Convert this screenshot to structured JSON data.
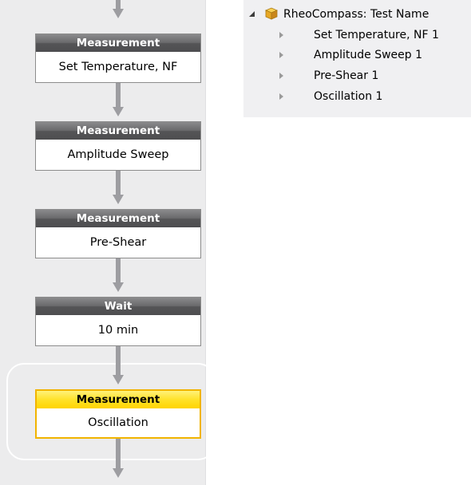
{
  "workflow": {
    "steps": [
      {
        "header": "Measurement",
        "label": "Set Temperature, NF"
      },
      {
        "header": "Measurement",
        "label": "Amplitude Sweep"
      },
      {
        "header": "Measurement",
        "label": "Pre-Shear"
      },
      {
        "header": "Wait",
        "label": "10 min"
      },
      {
        "header": "Measurement",
        "label": "Oscillation",
        "selected": true
      }
    ],
    "colors": {
      "step_header": "#5a5a5c",
      "selected_header": "#ffe22a",
      "selected_border": "#f1b400",
      "connector": "#9d9da1"
    }
  },
  "tree": {
    "root": {
      "label": "RheoCompass: Test Name",
      "icon": "package-icon",
      "expanded": true
    },
    "children": [
      {
        "label": "Set Temperature, NF 1"
      },
      {
        "label": "Amplitude Sweep 1"
      },
      {
        "label": "Pre-Shear 1"
      },
      {
        "label": "Oscillation 1"
      }
    ]
  }
}
